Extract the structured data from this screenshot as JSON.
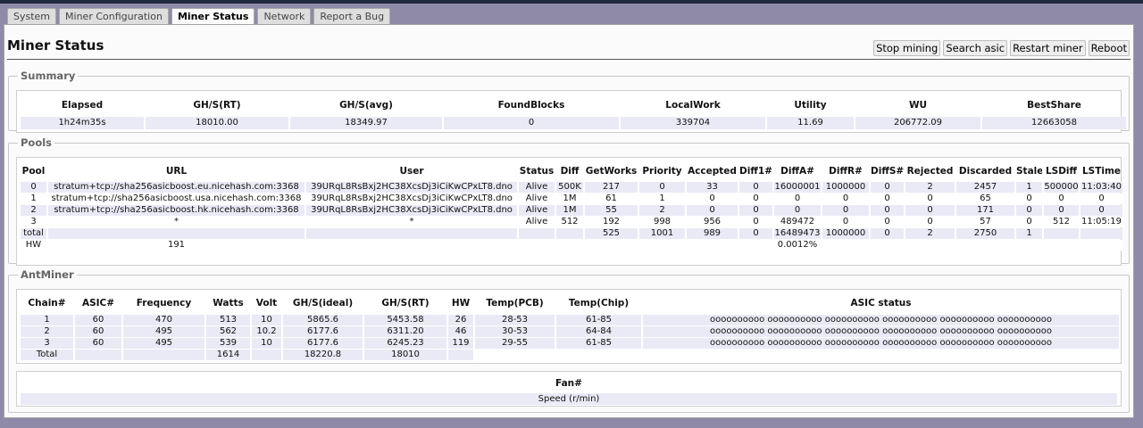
{
  "tabs": [
    "System",
    "Miner Configuration",
    "Miner Status",
    "Network",
    "Report a Bug"
  ],
  "active_tab": "Miner Status",
  "page_title": "Miner Status",
  "actions": {
    "stop_mining": "Stop mining",
    "search_asic": "Search asic",
    "restart_miner": "Restart miner",
    "reboot": "Reboot"
  },
  "summary": {
    "legend": "Summary",
    "headers": [
      "Elapsed",
      "GH/S(RT)",
      "GH/S(avg)",
      "FoundBlocks",
      "LocalWork",
      "Utility",
      "WU",
      "BestShare"
    ],
    "values": [
      "1h24m35s",
      "18010.00",
      "18349.97",
      "0",
      "339704",
      "11.69",
      "206772.09",
      "12663058"
    ]
  },
  "pools": {
    "legend": "Pools",
    "headers": [
      "Pool",
      "URL",
      "User",
      "Status",
      "Diff",
      "GetWorks",
      "Priority",
      "Accepted",
      "Diff1#",
      "DiffA#",
      "DiffR#",
      "DiffS#",
      "Rejected",
      "Discarded",
      "Stale",
      "LSDiff",
      "LSTime"
    ],
    "rows": [
      [
        "0",
        "stratum+tcp://sha256asicboost.eu.nicehash.com:3368",
        "39URqL8RsBxj2HC38XcsDj3iCiKwCPxLT8.dno",
        "Alive",
        "500K",
        "217",
        "0",
        "33",
        "0",
        "16000001",
        "1000000",
        "0",
        "2",
        "2457",
        "1",
        "500000",
        "11:03:40"
      ],
      [
        "1",
        "stratum+tcp://sha256asicboost.usa.nicehash.com:3368",
        "39URqL8RsBxj2HC38XcsDj3iCiKwCPxLT8.dno",
        "Alive",
        "1M",
        "61",
        "1",
        "0",
        "0",
        "0",
        "0",
        "0",
        "0",
        "65",
        "0",
        "0",
        "0"
      ],
      [
        "2",
        "stratum+tcp://sha256asicboost.hk.nicehash.com:3368",
        "39URqL8RsBxj2HC38XcsDj3iCiKwCPxLT8.dno",
        "Alive",
        "1M",
        "55",
        "2",
        "0",
        "0",
        "0",
        "0",
        "0",
        "0",
        "171",
        "0",
        "0",
        "0"
      ],
      [
        "3",
        "*",
        "*",
        "Alive",
        "512",
        "192",
        "998",
        "956",
        "0",
        "489472",
        "0",
        "0",
        "0",
        "57",
        "0",
        "512",
        "11:05:19"
      ],
      [
        "total",
        "",
        "",
        "",
        "",
        "525",
        "1001",
        "989",
        "0",
        "16489473",
        "1000000",
        "0",
        "2",
        "2750",
        "1",
        "",
        ""
      ],
      [
        "HW",
        "191",
        "",
        "",
        "",
        "",
        "",
        "",
        "",
        "0.0012%",
        "",
        "",
        "",
        "",
        "",
        "",
        ""
      ]
    ]
  },
  "antminer": {
    "legend": "AntMiner",
    "headers": [
      "Chain#",
      "ASIC#",
      "Frequency",
      "Watts",
      "Volt",
      "GH/S(ideal)",
      "GH/S(RT)",
      "HW",
      "Temp(PCB)",
      "Temp(Chip)",
      "ASIC status"
    ],
    "rows": [
      [
        "1",
        "60",
        "470",
        "513",
        "10",
        "5865.6",
        "5453.58",
        "26",
        "28-53",
        "61-85",
        "oooooooooo oooooooooo oooooooooo oooooooooo oooooooooo oooooooooo"
      ],
      [
        "2",
        "60",
        "495",
        "562",
        "10.2",
        "6177.6",
        "6311.20",
        "46",
        "30-53",
        "64-84",
        "oooooooooo oooooooooo oooooooooo oooooooooo oooooooooo oooooooooo"
      ],
      [
        "3",
        "60",
        "495",
        "539",
        "10",
        "6177.6",
        "6245.23",
        "119",
        "29-55",
        "61-85",
        "oooooooooo oooooooooo oooooooooo oooooooooo oooooooooo oooooooooo"
      ]
    ],
    "total": [
      "Total",
      "",
      "",
      "1614",
      "",
      "18220.8",
      "18010",
      ""
    ],
    "fan_header": "Fan#",
    "fan_row": "Speed (r/min)"
  }
}
